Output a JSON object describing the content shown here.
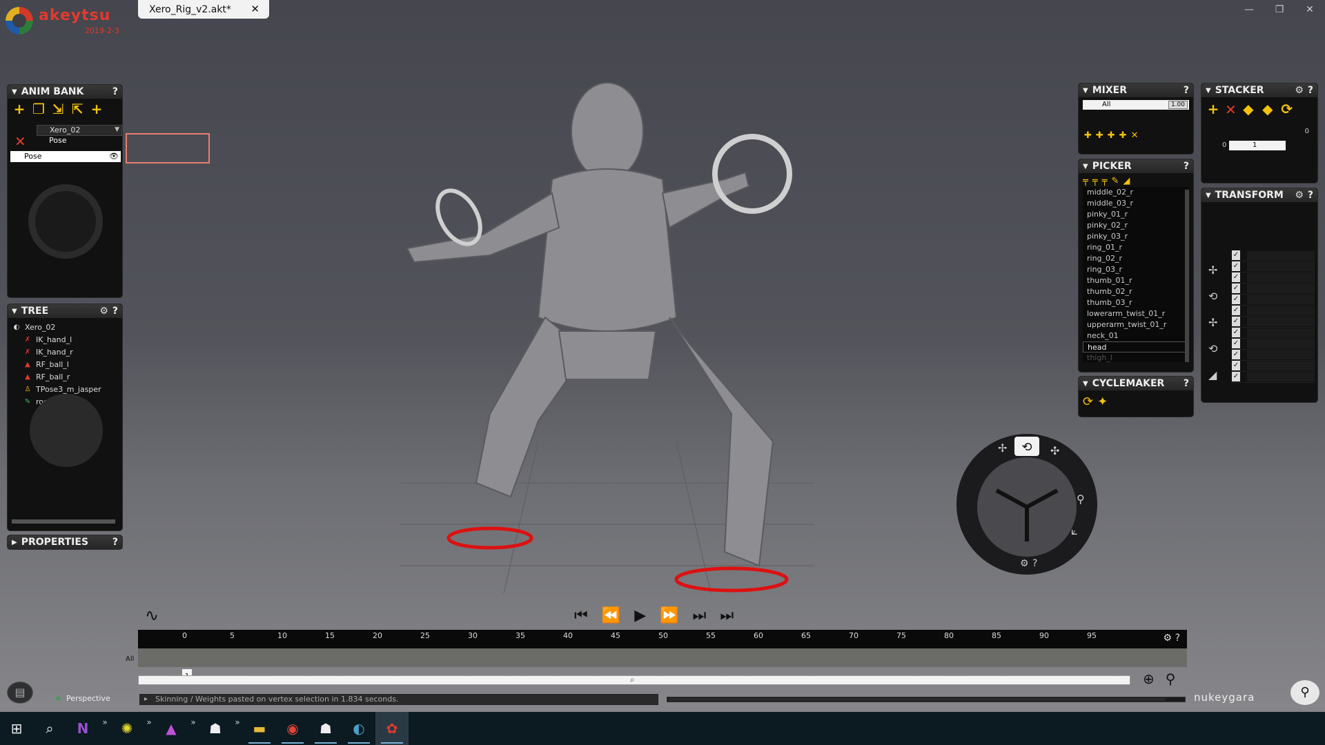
{
  "app": {
    "name": "akeytsu",
    "version": "2019-2-3",
    "brand": "nukeygara"
  },
  "document": {
    "tab_title": "Xero_Rig_v2.akt*",
    "close": "✕"
  },
  "window_controls": {
    "minimize": "—",
    "restore": "❐",
    "close": "✕"
  },
  "panels": {
    "anim_bank": {
      "title": "ANIM BANK",
      "help": "?",
      "character": "Xero_02",
      "sub_item": "Pose",
      "selected_row": "Pose"
    },
    "tree": {
      "title": "TREE",
      "help": "?",
      "items": [
        {
          "label": "Xero_02",
          "icon": "character-icon"
        },
        {
          "label": "IK_hand_l",
          "icon": "ik-icon"
        },
        {
          "label": "IK_hand_r",
          "icon": "ik-icon"
        },
        {
          "label": "RF_ball_l",
          "icon": "foot-icon"
        },
        {
          "label": "RF_ball_r",
          "icon": "foot-icon"
        },
        {
          "label": "TPose3_m_jasper",
          "icon": "pose-icon"
        },
        {
          "label": "root",
          "icon": "root-icon"
        }
      ]
    },
    "properties": {
      "title": "PROPERTIES",
      "help": "?"
    },
    "mixer": {
      "title": "MIXER",
      "help": "?",
      "row_label": "All",
      "row_value": "1.00"
    },
    "picker": {
      "title": "PICKER",
      "help": "?",
      "items": [
        "middle_02_r",
        "middle_03_r",
        "pinky_01_r",
        "pinky_02_r",
        "pinky_03_r",
        "ring_01_r",
        "ring_02_r",
        "ring_03_r",
        "thumb_01_r",
        "thumb_02_r",
        "thumb_03_r",
        "lowerarm_twist_01_r",
        "upperarm_twist_01_r",
        "neck_01",
        "head",
        "thigh_l"
      ],
      "selected": "head"
    },
    "cyclemaker": {
      "title": "CYCLEMAKER",
      "help": "?"
    },
    "stacker": {
      "title": "STACKER",
      "help": "?",
      "layer_value": "1",
      "left_value": "0",
      "right_value": "0"
    },
    "transform": {
      "title": "TRANSFORM",
      "help": "?"
    }
  },
  "timeline": {
    "ticks": [
      "0",
      "5",
      "10",
      "15",
      "20",
      "25",
      "30",
      "35",
      "40",
      "45",
      "50",
      "55",
      "60",
      "65",
      "70",
      "75",
      "80",
      "85",
      "90",
      "95"
    ],
    "track_label": "All",
    "current_frame": "1",
    "settings_glyph": "⚙",
    "help": "?"
  },
  "playback": {
    "first": "⏮",
    "prev_key": "⏪",
    "play": "▶",
    "next_key": "⏩",
    "last": "⏭",
    "end": "⏭"
  },
  "status": {
    "camera": "Perspective",
    "message": "Skinning / Weights pasted on vertex selection in 1.834 seconds."
  },
  "taskbar": {
    "items": [
      {
        "name": "windows-start",
        "glyph": "⊞"
      },
      {
        "name": "search",
        "glyph": "⌕"
      },
      {
        "name": "onenote",
        "glyph": "N"
      },
      {
        "name": "app-yellow",
        "glyph": "✺"
      },
      {
        "name": "affinity",
        "glyph": "▲"
      },
      {
        "name": "app-figure",
        "glyph": "☗"
      },
      {
        "name": "file-explorer",
        "glyph": "▬"
      },
      {
        "name": "chrome",
        "glyph": "◉"
      },
      {
        "name": "app-figure-2",
        "glyph": "☗"
      },
      {
        "name": "app-blue",
        "glyph": "◐"
      },
      {
        "name": "akeytsu",
        "glyph": "✿"
      }
    ]
  },
  "colors": {
    "accent_red": "#e23a2e",
    "tool_yellow": "#f4c20d",
    "panel_bg": "#111111"
  }
}
